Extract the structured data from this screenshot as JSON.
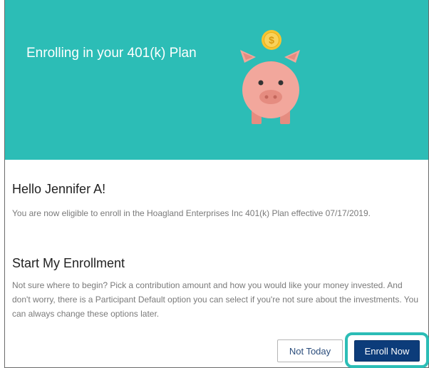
{
  "banner": {
    "title": "Enrolling in your 401(k) Plan",
    "coin_symbol": "$",
    "colors": {
      "background": "#2cbdb6",
      "piggy": "#f2a79c",
      "coin": "#f7c431"
    }
  },
  "greeting": "Hello Jennifer A!",
  "eligibility_text": "You are now eligible to enroll in the Hoagland Enterprises Inc 401(k) Plan effective 07/17/2019.",
  "enrollment": {
    "heading": "Start My Enrollment",
    "body": "Not sure where to begin? Pick a contribution amount and how you would like your money invested. And don't worry, there is a Participant Default option you can select if you're not sure about the investments. You can always change these options later."
  },
  "actions": {
    "not_today_label": "Not Today",
    "enroll_now_label": "Enroll Now"
  }
}
